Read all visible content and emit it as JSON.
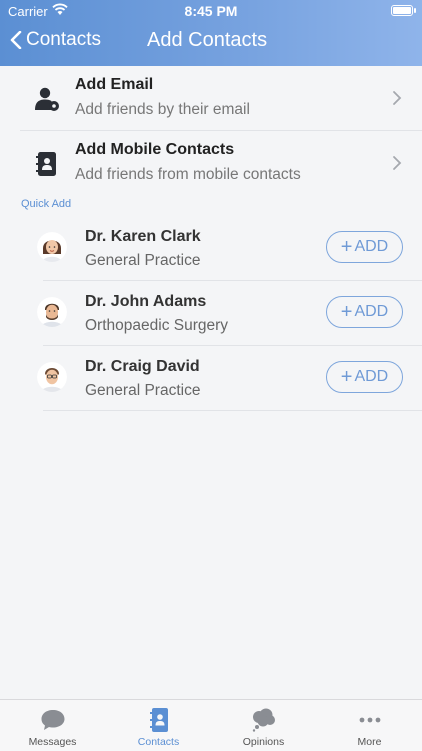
{
  "status": {
    "carrier": "Carrier",
    "time": "8:45 PM"
  },
  "nav": {
    "back_label": "Contacts",
    "title": "Add Contacts"
  },
  "options": [
    {
      "title": "Add Email",
      "subtitle": "Add friends by their email",
      "icon": "person-gear-icon"
    },
    {
      "title": "Add Mobile Contacts",
      "subtitle": "Add friends from mobile contacts",
      "icon": "address-book-icon"
    }
  ],
  "quick_add_label": "Quick Add",
  "contacts": [
    {
      "name": "Dr. Karen Clark",
      "specialty": "General Practice",
      "add_label": "ADD"
    },
    {
      "name": "Dr. John Adams",
      "specialty": "Orthopaedic Surgery",
      "add_label": "ADD"
    },
    {
      "name": "Dr. Craig David",
      "specialty": "General Practice",
      "add_label": "ADD"
    }
  ],
  "tabs": [
    {
      "label": "Messages",
      "icon": "chat-bubble-icon",
      "active": false
    },
    {
      "label": "Contacts",
      "icon": "contacts-book-icon",
      "active": true
    },
    {
      "label": "Opinions",
      "icon": "thought-cloud-icon",
      "active": false
    },
    {
      "label": "More",
      "icon": "ellipsis-icon",
      "active": false
    }
  ],
  "colors": {
    "accent": "#5b8fd3",
    "header_gradient_end": "#8fb4ea",
    "background": "#f4f5f7"
  }
}
